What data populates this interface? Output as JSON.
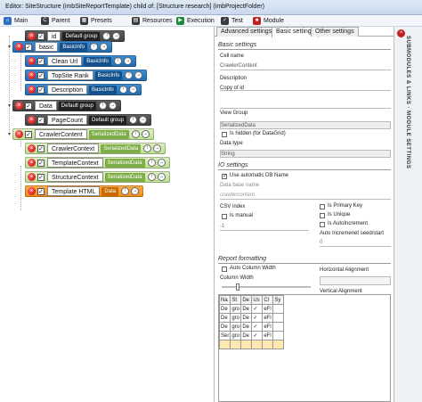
{
  "window": {
    "title": "Editor: SiteStructure (imbSiteReportTemplate) child of: [Structure research] (imbProjectFolder)"
  },
  "menu": [
    {
      "label": "Main",
      "icon": "home-icon",
      "color": "#2f6fc2"
    },
    {
      "label": "Parent",
      "icon": "parent-icon",
      "color": "#3a3a3a"
    },
    {
      "label": "Presets",
      "icon": "presets-icon",
      "color": "#3a3a3a"
    },
    {
      "label": "Resources",
      "icon": "resources-icon",
      "color": "#3a3a3a"
    },
    {
      "label": "Execution",
      "icon": "execution-icon",
      "color": "#1c8a3a"
    },
    {
      "label": "Test",
      "icon": "test-icon",
      "color": "#3a3a3a"
    },
    {
      "label": "Module",
      "icon": "module-icon",
      "color": "#c02020"
    }
  ],
  "tree": {
    "nodes": [
      {
        "label": "id",
        "tag": "Default group"
      },
      {
        "label": "basic",
        "tag": "BasicInfo"
      },
      {
        "label": "Clean Url",
        "tag": "BasicInfo"
      },
      {
        "label": "TopSite Rank",
        "tag": "BasicInfo"
      },
      {
        "label": "Description",
        "tag": "BasicInfo"
      },
      {
        "label": "Data",
        "tag": "Default group"
      },
      {
        "label": "PageCount",
        "tag": "Default group"
      },
      {
        "label": "CrawlerContent",
        "tag": "SerializedData"
      },
      {
        "label": "CrawlerContext",
        "tag": "SerializedData"
      },
      {
        "label": "TemplateContext",
        "tag": "SerializedData"
      },
      {
        "label": "StructureContext",
        "tag": "SerializedData"
      },
      {
        "label": "Template HTML",
        "tag": "Data"
      }
    ],
    "check": "✓",
    "remove_glyph": "×",
    "expand_glyph": "▾",
    "up_glyph": "↑",
    "next_glyph": "→"
  },
  "tabs": [
    "Advanced settings",
    "Basic settings",
    "Other settings"
  ],
  "basic": {
    "header": "Basic settings",
    "cell_name_label": "Cell name",
    "cell_name_value": "CrawlerContent",
    "description_label": "Description",
    "copy_of_id_label": "Copy of id",
    "view_group_label": "View Group",
    "view_group_value": "SerializedData",
    "is_hidden_label": "Is hidden (for DataGrid)",
    "data_type_label": "Data type",
    "data_type_value": "String"
  },
  "io": {
    "header": "IO settings",
    "auto_db_label": "Use automatic DB Name",
    "db_name_label": "Data base name",
    "db_name_value": "crawlercontent",
    "csv_index_label": "CSV index",
    "is_manual_label": "Is manual",
    "csv_value": "-1",
    "is_primary_label": "Is Primary Key",
    "is_unique_label": "Is Unique",
    "is_autoinc_label": "Is AutoIncrement",
    "autoinc_seed_label": "Auto Incremenet seed/start",
    "autoinc_value": "0"
  },
  "report": {
    "header": "Report formatting",
    "auto_col_label": "Auto Column Width",
    "col_width_label": "Column Width",
    "h_align_label": "Horizontal Alignment",
    "v_align_label": "Vertical Alignment"
  },
  "grid": {
    "headers": [
      "Na",
      "St",
      "De",
      "Us",
      "Cl",
      "Sy"
    ],
    "rows": [
      [
        "De",
        "gro",
        "De",
        "✓",
        "eFl",
        ""
      ],
      [
        "De",
        "gro",
        "De",
        "✓",
        "eFl",
        ""
      ],
      [
        "De",
        "gro",
        "De",
        "✓",
        "eFl",
        ""
      ],
      [
        "Ser",
        "gro",
        "De",
        "✓",
        "eFl",
        ""
      ],
      [
        "",
        "",
        "",
        "",
        "",
        ""
      ]
    ]
  },
  "side": {
    "label": "SUBMODULES & LINKS · MODULE SETTINGS"
  }
}
